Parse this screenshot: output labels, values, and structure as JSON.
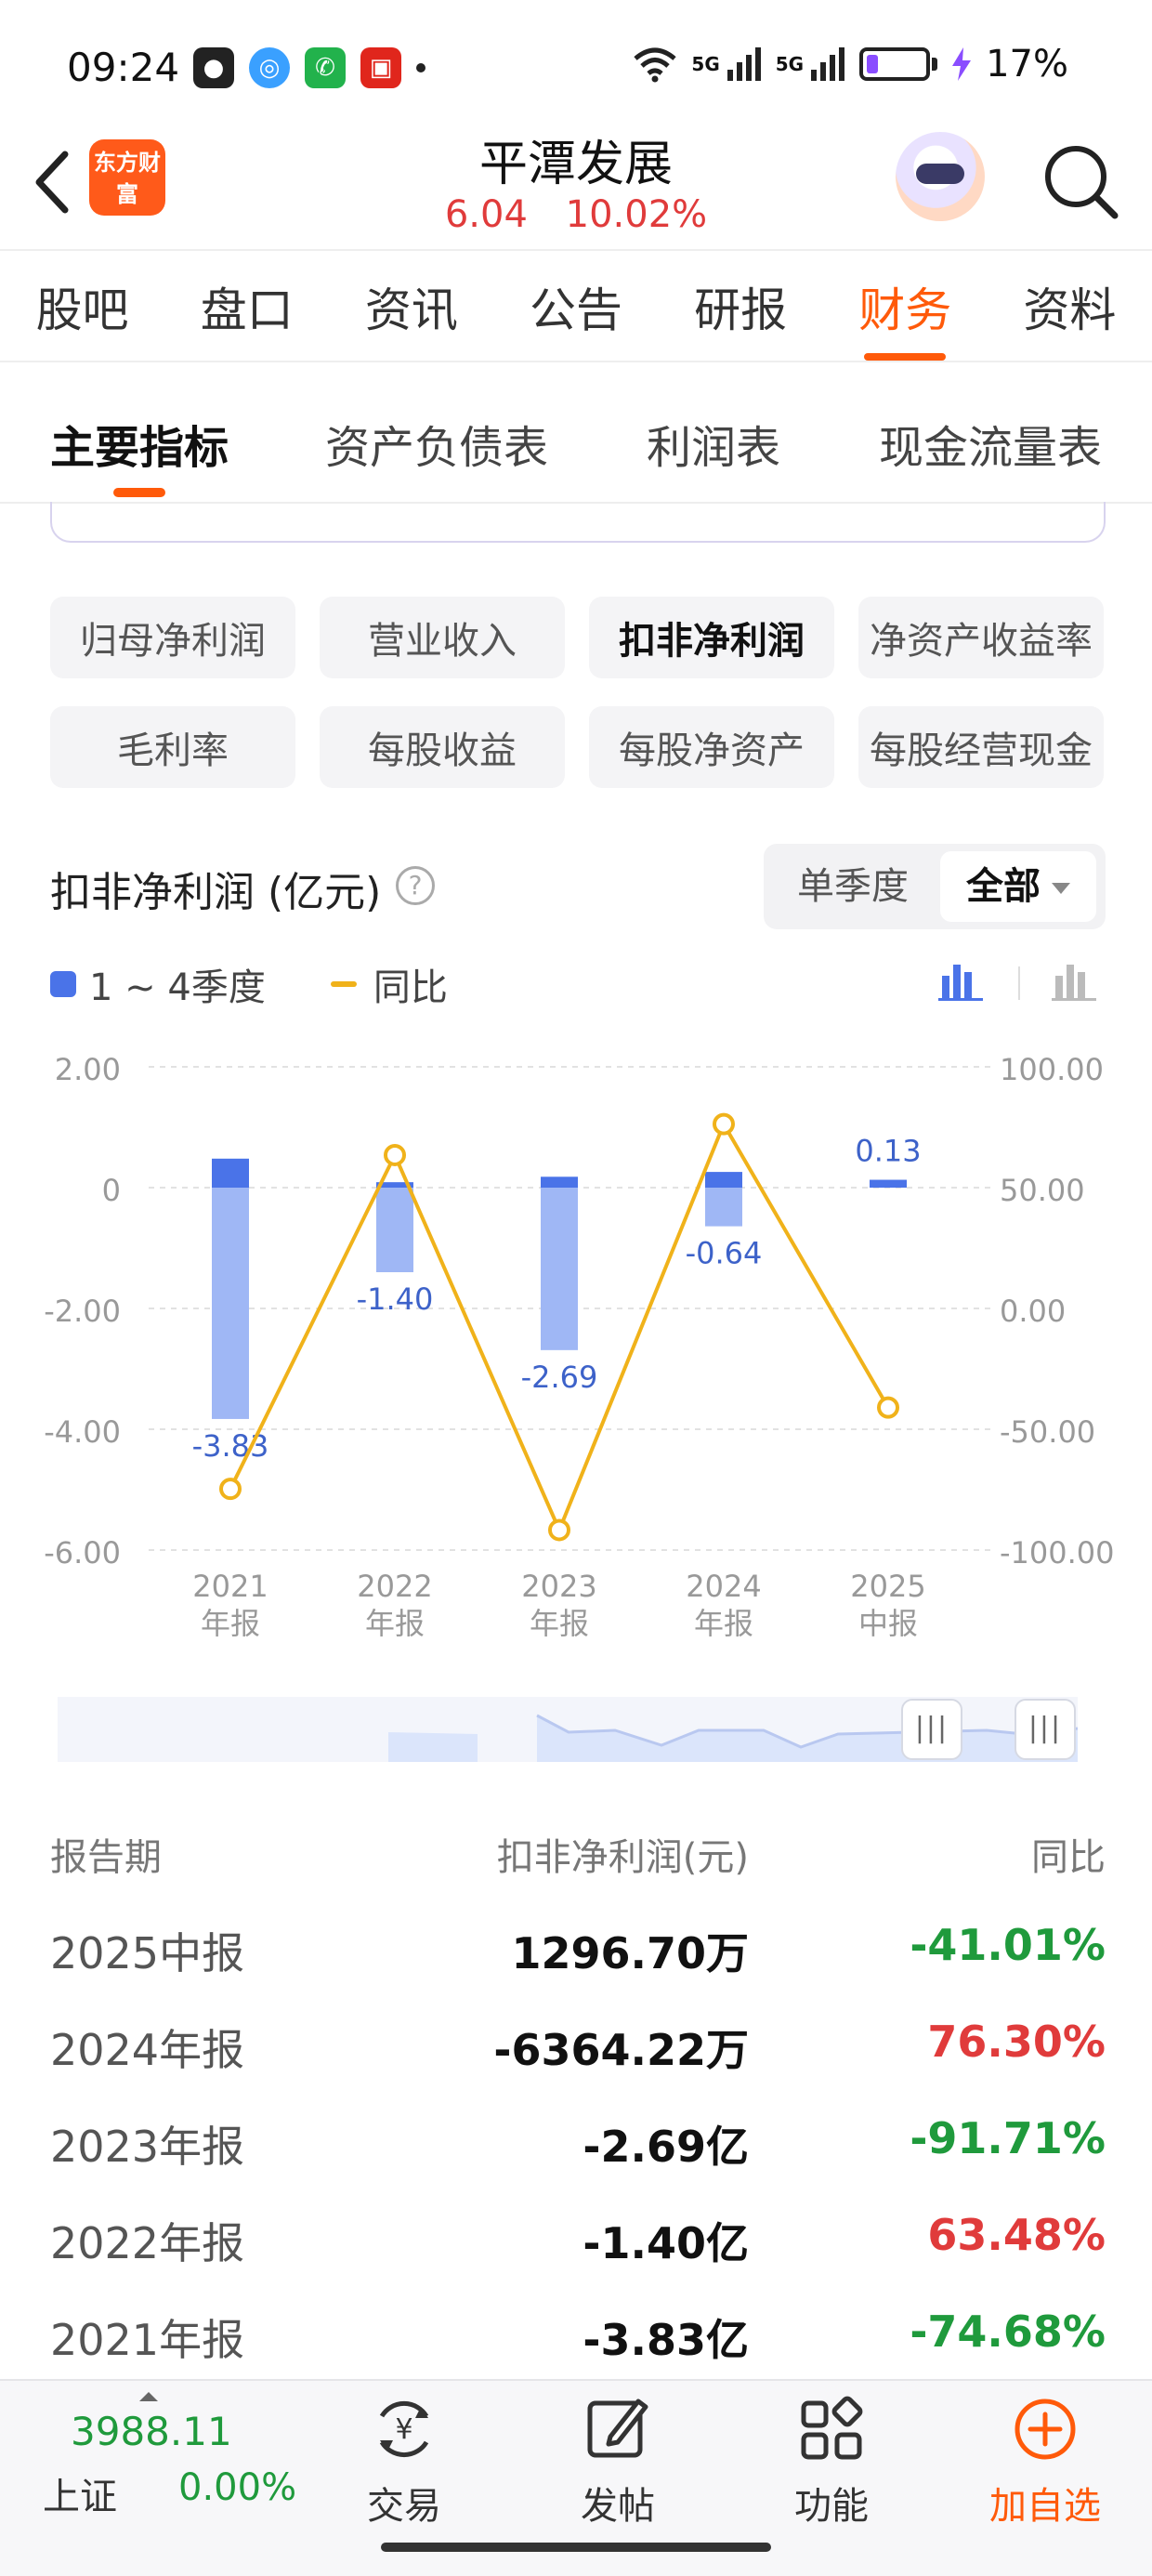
{
  "status": {
    "time": "09:24",
    "net1": "5G",
    "net2": "5G",
    "battery": "17%"
  },
  "header": {
    "logo": "东方财富",
    "stock_name": "平潭发展",
    "price": "6.04",
    "change_pct": "10.02%"
  },
  "main_tabs": [
    "股吧",
    "盘口",
    "资讯",
    "公告",
    "研报",
    "财务",
    "资料"
  ],
  "main_tab_active": "财务",
  "sub_tabs": [
    "主要指标",
    "资产负债表",
    "利润表",
    "现金流量表"
  ],
  "metric_chips": [
    "归母净利润",
    "营业收入",
    "扣非净利润",
    "净资产收益率",
    "毛利率",
    "每股收益",
    "每股净资产",
    "每股经营现金"
  ],
  "metric_selected": "扣非净利润",
  "chart_header": {
    "title": "扣非净利润 (亿元)",
    "help": "?",
    "period_options": [
      "单季度",
      "全部"
    ],
    "period_active": "全部"
  },
  "legend": {
    "bars": "1 ~ 4季度",
    "line": "同比"
  },
  "colors": {
    "accent": "#ff5a0a",
    "up": "#e03b3b",
    "down": "#1f9a3c",
    "bar": "#9fb7f5",
    "bar_dark": "#4a73e8",
    "line": "#f0b21a"
  },
  "chart_data": {
    "type": "bar",
    "categories": [
      "2021\n年报",
      "2022\n年报",
      "2023\n年报",
      "2024\n年报",
      "2025\n中报"
    ],
    "category_top": [
      "2021",
      "2022",
      "2023",
      "2024",
      "2025"
    ],
    "category_bottom": [
      "年报",
      "年报",
      "年报",
      "年报",
      "中报"
    ],
    "series": [
      {
        "name": "1 ~ 4季度",
        "axis": "left",
        "values": [
          -3.83,
          -1.4,
          -2.69,
          -0.64,
          0.13
        ]
      },
      {
        "name": "同比",
        "axis": "right",
        "values": [
          -74.68,
          63.48,
          -91.71,
          76.3,
          -41.01
        ]
      }
    ],
    "bar_positive_parts": [
      0.48,
      0.09,
      0.18,
      0.26,
      0.13
    ],
    "data_labels": [
      "-3.83",
      "-1.40",
      "-2.69",
      "-0.64",
      "0.13"
    ],
    "left_ticks": [
      "2.00",
      "0",
      "-2.00",
      "-4.00",
      "-6.00"
    ],
    "right_ticks": [
      "100.00",
      "50.00",
      "0.00",
      "-50.00",
      "-100.00"
    ],
    "ylim_left": [
      -6,
      2
    ],
    "ylim_right": [
      -100,
      100
    ],
    "grid": true
  },
  "table": {
    "headers": [
      "报告期",
      "扣非净利润(元)",
      "同比"
    ],
    "rows": [
      {
        "period": "2025中报",
        "value": "1296.70万",
        "yoy": "-41.01%",
        "dir": "down"
      },
      {
        "period": "2024年报",
        "value": "-6364.22万",
        "yoy": "76.30%",
        "dir": "up"
      },
      {
        "period": "2023年报",
        "value": "-2.69亿",
        "yoy": "-91.71%",
        "dir": "down"
      },
      {
        "period": "2022年报",
        "value": "-1.40亿",
        "yoy": "63.48%",
        "dir": "up"
      },
      {
        "period": "2021年报",
        "value": "-3.83亿",
        "yoy": "-74.68%",
        "dir": "down"
      }
    ]
  },
  "bottom_nav": {
    "index_value": "3988.11",
    "index_name": "上证",
    "index_change": "0.00%",
    "items": [
      "交易",
      "发帖",
      "功能",
      "加自选"
    ]
  }
}
